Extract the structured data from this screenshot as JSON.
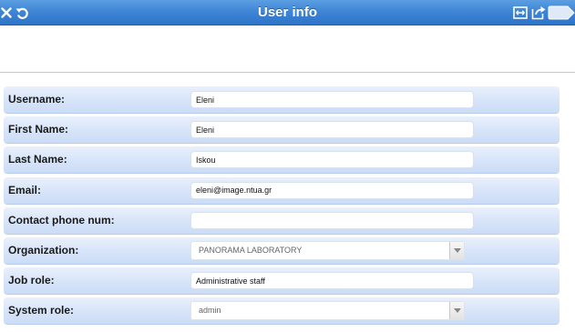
{
  "window": {
    "title": "User info",
    "accent": "#3f86d6",
    "icons": {
      "left": [
        "close-icon",
        "refresh-icon"
      ],
      "right": [
        "fit-width-icon",
        "share-icon",
        "tab-icon"
      ]
    }
  },
  "form": {
    "rows": [
      {
        "label": "Username:",
        "value": "Eleni",
        "type": "text"
      },
      {
        "label": "First Name:",
        "value": "Eleni",
        "type": "text"
      },
      {
        "label": "Last Name:",
        "value": "Iskou",
        "type": "text"
      },
      {
        "label": "Email:",
        "value": "eleni@image.ntua.gr",
        "type": "text"
      },
      {
        "label": "Contact phone num:",
        "value": "",
        "type": "text"
      },
      {
        "label": "Organization:",
        "value": "PANORAMA LABORATORY",
        "type": "select"
      },
      {
        "label": "Job role:",
        "value": "Administrative staff",
        "type": "text"
      },
      {
        "label": "System role:",
        "value": "admin",
        "type": "select"
      }
    ]
  }
}
